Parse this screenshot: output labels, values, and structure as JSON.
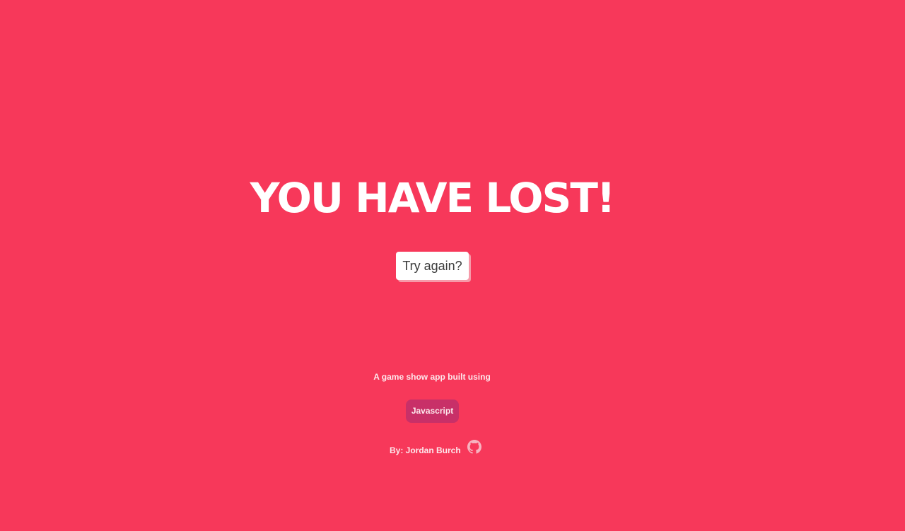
{
  "overlay": {
    "title": "YOU HAVE LOST!",
    "reset_button_label": "Try again?",
    "background_color": "#f7385a"
  },
  "footer": {
    "built_with_text": "A game show app built using",
    "tech_badge": "Javascript",
    "author_text": "By: Jordan Burch",
    "author_icon": "github-icon"
  }
}
